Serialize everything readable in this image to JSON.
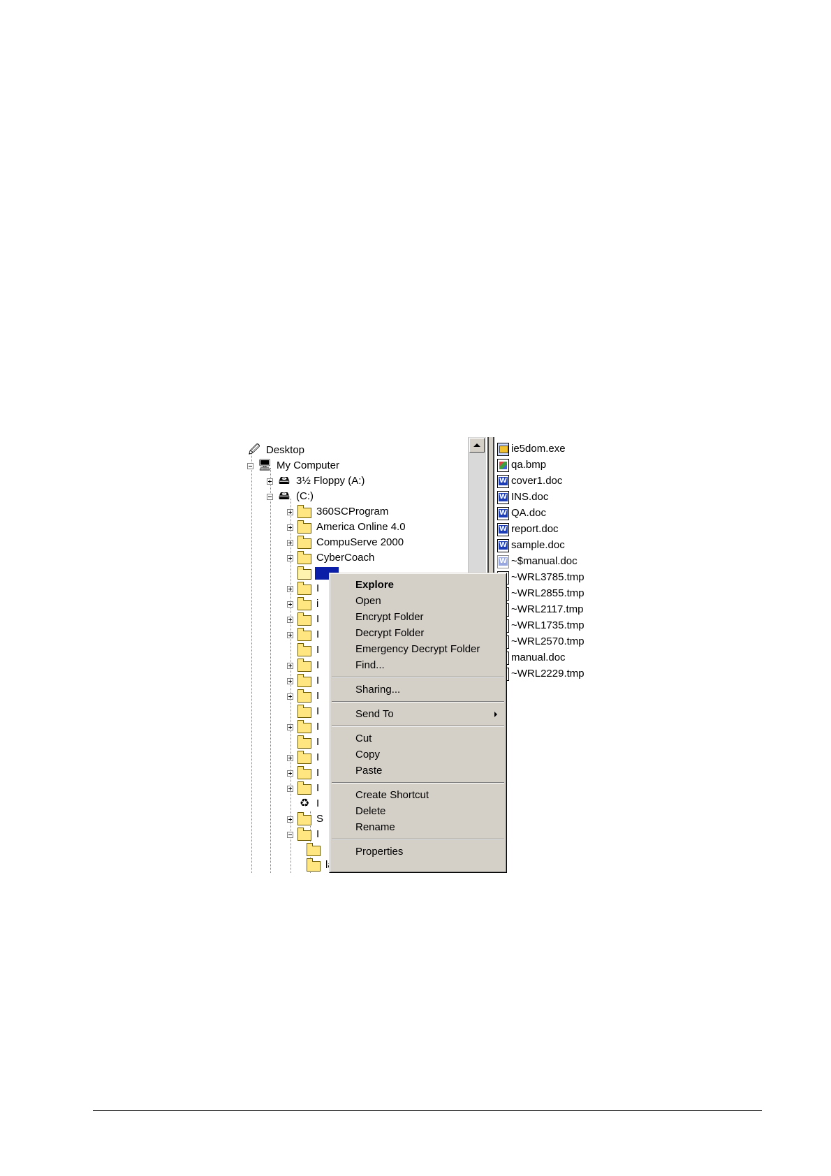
{
  "tree": {
    "desktop": "Desktop",
    "my_computer": "My Computer",
    "floppy": "3½ Floppy (A:)",
    "drive_c": "(C:)",
    "folders": [
      "360SCProgram",
      "America Online 4.0",
      "CompuServe 2000",
      "CyberCoach"
    ],
    "selected_folder": "",
    "partial_folders": [
      "I",
      "i",
      "I",
      "I",
      "I",
      "I",
      "I",
      "I",
      "I",
      "I",
      "I",
      "I",
      "I",
      "I",
      "I",
      "I",
      "S",
      "I"
    ],
    "bottom_folder": "lacy1"
  },
  "files": [
    {
      "name": "ie5dom.exe",
      "icon": "exe-icon"
    },
    {
      "name": "qa.bmp",
      "icon": "bitmap-icon"
    },
    {
      "name": "cover1.doc",
      "icon": "word-doc-icon"
    },
    {
      "name": "INS.doc",
      "icon": "word-doc-icon"
    },
    {
      "name": "QA.doc",
      "icon": "word-doc-icon"
    },
    {
      "name": "report.doc",
      "icon": "word-doc-icon"
    },
    {
      "name": "sample.doc",
      "icon": "word-doc-icon"
    },
    {
      "name": "~$manual.doc",
      "icon": "word-doc-icon"
    },
    {
      "name": "~WRL3785.tmp",
      "icon": "file-icon"
    },
    {
      "name": "~WRL2855.tmp",
      "icon": "file-icon"
    },
    {
      "name": "~WRL2117.tmp",
      "icon": "file-icon"
    },
    {
      "name": "~WRL1735.tmp",
      "icon": "file-icon"
    },
    {
      "name": "~WRL2570.tmp",
      "icon": "file-icon"
    },
    {
      "name": "manual.doc",
      "icon": "file-icon"
    },
    {
      "name": "~WRL2229.tmp",
      "icon": "file-icon"
    }
  ],
  "context_menu": {
    "explore": "Explore",
    "open": "Open",
    "encrypt": "Encrypt Folder",
    "decrypt": "Decrypt Folder",
    "emergency_decrypt": "Emergency Decrypt Folder",
    "find": "Find...",
    "sharing": "Sharing...",
    "send_to": "Send To",
    "cut": "Cut",
    "copy": "Copy",
    "paste": "Paste",
    "create_shortcut": "Create Shortcut",
    "delete": "Delete",
    "rename": "Rename",
    "properties": "Properties"
  }
}
